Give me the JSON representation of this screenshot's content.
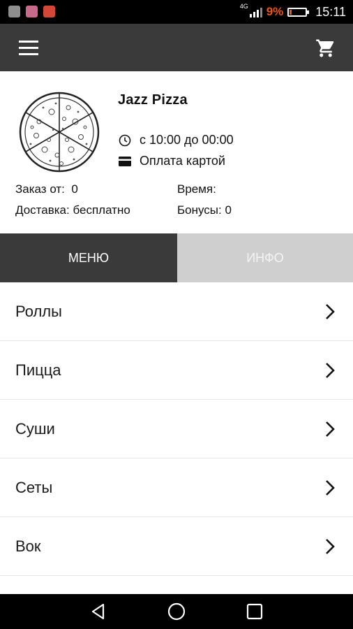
{
  "status_bar": {
    "network": "4G",
    "battery_percent": "9%",
    "battery_color": "#e8551a",
    "time": "15:11",
    "apps": [
      "gallery-icon",
      "instagram-icon",
      "gmail-icon"
    ]
  },
  "toolbar": {
    "menu_icon": "hamburger-icon",
    "cart_icon": "cart-icon",
    "background": "#3a3a3a"
  },
  "restaurant": {
    "name": "Jazz Pizza",
    "hours": "с 10:00 до 00:00",
    "payment": "Оплата картой",
    "min_order": "Заказ от:  0",
    "time": "Время:",
    "delivery": "Доставка: бесплатно",
    "bonuses": "Бонусы: 0"
  },
  "tabs": [
    {
      "label": "МЕНЮ",
      "active": true
    },
    {
      "label": "ИНФО",
      "active": false
    }
  ],
  "categories": [
    {
      "label": "Роллы"
    },
    {
      "label": "Пицца"
    },
    {
      "label": "Суши"
    },
    {
      "label": "Сеты"
    },
    {
      "label": "Вок"
    }
  ]
}
